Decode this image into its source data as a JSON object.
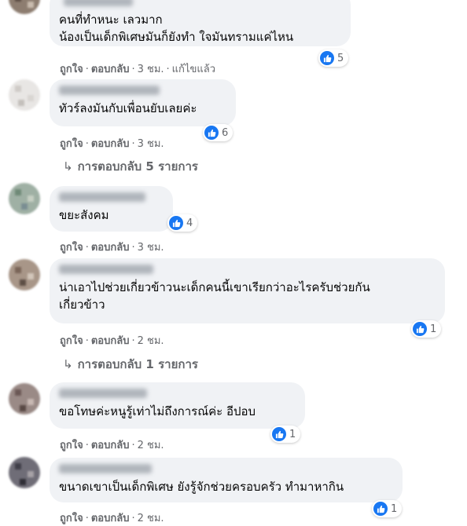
{
  "actions": {
    "like": "ถูกใจ",
    "reply": "ตอบกลับ",
    "sep": "·"
  },
  "colors": {
    "like_blue": "#1877f2",
    "bubble_bg": "#f0f2f5",
    "meta_gray": "#65676b"
  },
  "icons": {
    "like": "thumbs-up-icon",
    "reply_arrow": "reply-arrow-icon"
  },
  "comments": [
    {
      "lines": [
        "คนที่ทำหนะ เลวมาก",
        "น้องเป็นเด็กพิเศษมันก็ยังทำ ใจมันทรามแค่ไหน"
      ],
      "time": "3 ชม.",
      "edited": "แก้ไขแล้ว",
      "likes": "5"
    },
    {
      "lines": [
        "ทัวร์ลงมันกับเพื่อนยับเลยค่ะ"
      ],
      "time": "3 ชม.",
      "likes": "6",
      "replies": "การตอบกลับ 5 รายการ"
    },
    {
      "lines": [
        "ขยะสังคม"
      ],
      "time": "3 ชม.",
      "likes": "4"
    },
    {
      "lines": [
        "น่าเอาไปช่วยเกี่ยวข้าวนะเด็กคนนี้เขาเรียกว่าอะไรครับช่วยกัน",
        "เกี่ยวข้าว"
      ],
      "time": "2 ชม.",
      "likes": "1",
      "replies": "การตอบกลับ 1 รายการ"
    },
    {
      "lines": [
        "ขอโทษค่ะหนูรู้เท่าไม่ถึงการณ์ค่ะ อีปอบ"
      ],
      "time": "2 ชม.",
      "likes": "1"
    },
    {
      "lines": [
        "ขนาดเขาเป็นเด็กพิเศษ ยังรู้จักช่วยครอบครัว ทำมาหากิน"
      ],
      "time": "2 ชม.",
      "likes": "1"
    }
  ]
}
